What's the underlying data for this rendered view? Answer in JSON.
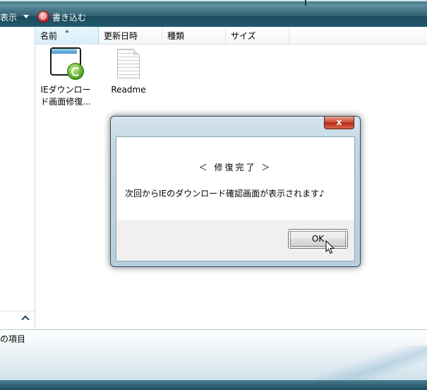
{
  "toolbar": {
    "view_label": "表示",
    "burn_label": "書き込む"
  },
  "columns": {
    "name": "名前",
    "date_modified": "更新日時",
    "type": "種類",
    "size": "サイズ"
  },
  "files": [
    {
      "label": "IEダウンロード画面修復...",
      "icon": "ie-repair-app-icon"
    },
    {
      "label": "Readme",
      "icon": "text-document-icon"
    }
  ],
  "status": {
    "text": "の項目"
  },
  "dialog": {
    "close_symbol": "x",
    "heading": "＜ 修復完了 ＞",
    "message": "次回からIEのダウンロード確認画面が表示されます♪",
    "ok_label": "OK"
  },
  "colors": {
    "toolbar": "#2f6071",
    "close_button": "#c94631",
    "dialog_frame": "#c2d7e4",
    "column_header_active": "#d9effc"
  }
}
